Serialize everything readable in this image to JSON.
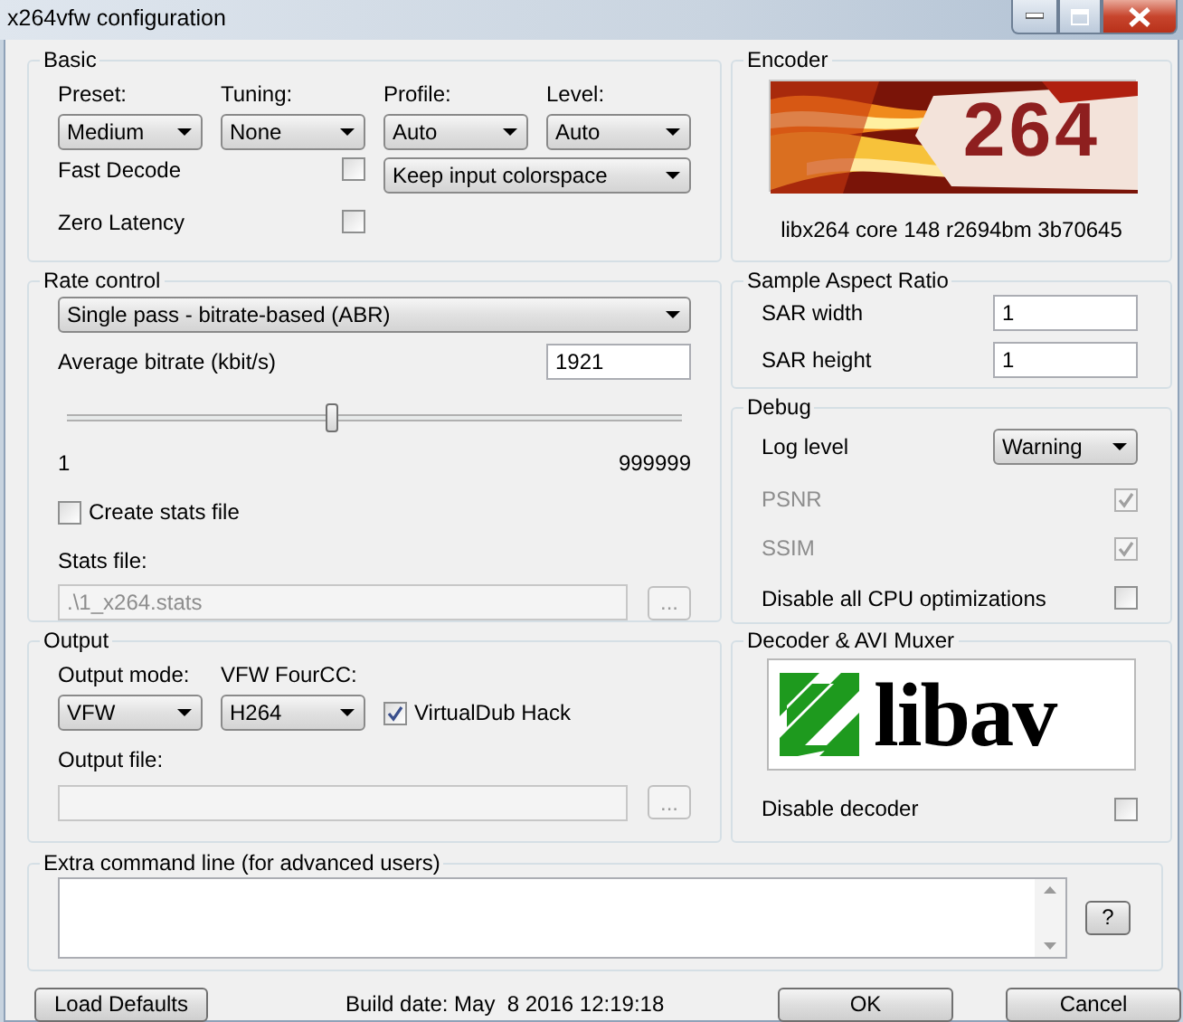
{
  "window": {
    "title": "x264vfw configuration"
  },
  "basic": {
    "title": "Basic",
    "fields": [
      {
        "label": "Preset:",
        "value": "Medium"
      },
      {
        "label": "Tuning:",
        "value": "None"
      },
      {
        "label": "Profile:",
        "value": "Auto"
      },
      {
        "label": "Level:",
        "value": "Auto"
      }
    ],
    "fast_decode": {
      "label": "Fast Decode",
      "checked": false
    },
    "colorspace": {
      "value": "Keep input colorspace"
    },
    "zero_latency": {
      "label": "Zero Latency",
      "checked": false
    }
  },
  "encoder": {
    "title": "Encoder",
    "logo_text": "264",
    "version": "libx264 core 148 r2694bm 3b70645"
  },
  "rate_control": {
    "title": "Rate control",
    "mode": "Single pass - bitrate-based (ABR)",
    "bitrate_label": "Average bitrate (kbit/s)",
    "bitrate": "1921",
    "slider": {
      "level": 0.43,
      "min_label": "1",
      "max_label": "999999"
    },
    "create_stats": {
      "label": "Create stats file",
      "checked": false
    },
    "stats_file": {
      "label": "Stats file:",
      "value": ".\\1_x264.stats",
      "disabled": true
    },
    "browse": {
      "label": "...",
      "disabled": true
    }
  },
  "sar": {
    "title": "Sample Aspect Ratio",
    "fields": [
      {
        "label": "SAR width",
        "value": "1"
      },
      {
        "label": "SAR height",
        "value": "1"
      }
    ]
  },
  "debug": {
    "title": "Debug",
    "log_level": {
      "label": "Log level",
      "value": "Warning"
    },
    "options": [
      {
        "label": "PSNR",
        "checked": true,
        "disabled": true
      },
      {
        "label": "SSIM",
        "checked": true,
        "disabled": true
      },
      {
        "label": "Disable all CPU optimizations",
        "checked": false,
        "disabled": false
      }
    ]
  },
  "output": {
    "title": "Output",
    "mode": {
      "label": "Output mode:",
      "value": "VFW"
    },
    "fourcc": {
      "label": "VFW FourCC:",
      "value": "H264"
    },
    "vdub_hack": {
      "label": "VirtualDub Hack",
      "checked": true
    },
    "output_file": {
      "label": "Output file:",
      "disabled": true
    },
    "browse": {
      "label": "...",
      "disabled": true
    }
  },
  "decoder": {
    "title": "Decoder & AVI Muxer",
    "logo_text": "libav",
    "disable_decoder": {
      "label": "Disable decoder",
      "checked": false
    }
  },
  "extra": {
    "title": "Extra command line (for advanced users)",
    "help": "?"
  },
  "footer": {
    "load_defaults": "Load Defaults",
    "build_date": "Build date: May  8 2016 12:19:18",
    "ok": "OK",
    "cancel": "Cancel"
  }
}
